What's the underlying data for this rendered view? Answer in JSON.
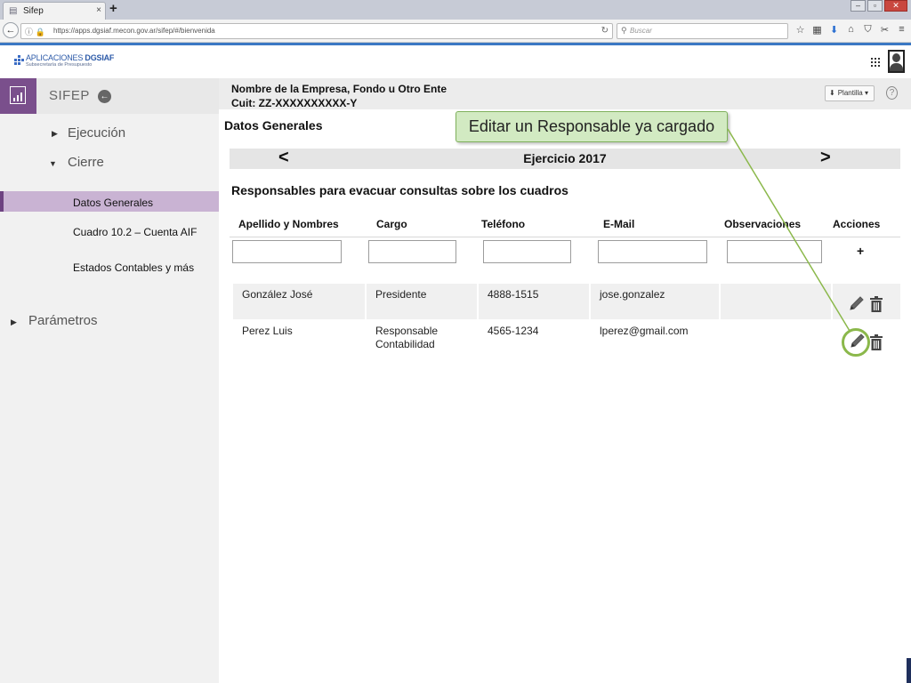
{
  "browser": {
    "tab_title": "Sifep",
    "tab_close": "×",
    "new_tab": "+",
    "url": "https://apps.dgsiaf.mecon.gov.ar/sifep/#/bienvenida",
    "search_placeholder": "Buscar"
  },
  "app": {
    "logo_title_a": "APLICACIONES ",
    "logo_title_b": "DGSIAF",
    "logo_subtitle": "Subsecretaría de Presupuesto"
  },
  "sidebar": {
    "title": "SIFEP",
    "items": [
      {
        "label": "Ejecución"
      },
      {
        "label": "Cierre"
      },
      {
        "label": "Parámetros"
      }
    ],
    "subitems": [
      {
        "label": "Datos Generales"
      },
      {
        "label": "Cuadro 10.2  – Cuenta AIF"
      },
      {
        "label": "Estados Contables y más"
      }
    ]
  },
  "entity": {
    "name": "Nombre de la Empresa, Fondo u Otro Ente",
    "cuit": "Cuit: ZZ-XXXXXXXXXX-Y"
  },
  "toolbar": {
    "plantilla_label": "Plantilla",
    "help": "?"
  },
  "main": {
    "section_title": "Datos Generales",
    "callout": "Editar un Responsable ya cargado",
    "year_prev": "<",
    "year_next": ">",
    "year_label": "Ejercicio 2017",
    "subtitle": "Responsables para evacuar consultas sobre los cuadros",
    "add_label": "+",
    "columns": [
      "Apellido y Nombres",
      "Cargo",
      "Teléfono",
      "E-Mail",
      "Observaciones",
      "Acciones"
    ],
    "rows": [
      {
        "name": "González José",
        "cargo": "Presidente",
        "telefono": "4888-1515",
        "email": "jose.gonzalez",
        "observaciones": ""
      },
      {
        "name": "Perez Luis",
        "cargo": "Responsable Contabilidad",
        "telefono": "4565-1234",
        "email": "lperez@gmail.com",
        "observaciones": ""
      }
    ]
  },
  "colors": {
    "accent_purple": "#7a4f8c",
    "active_item": "#c9b3d3",
    "callout_green": "#d2eac2",
    "highlight_green": "#8bb84b"
  }
}
